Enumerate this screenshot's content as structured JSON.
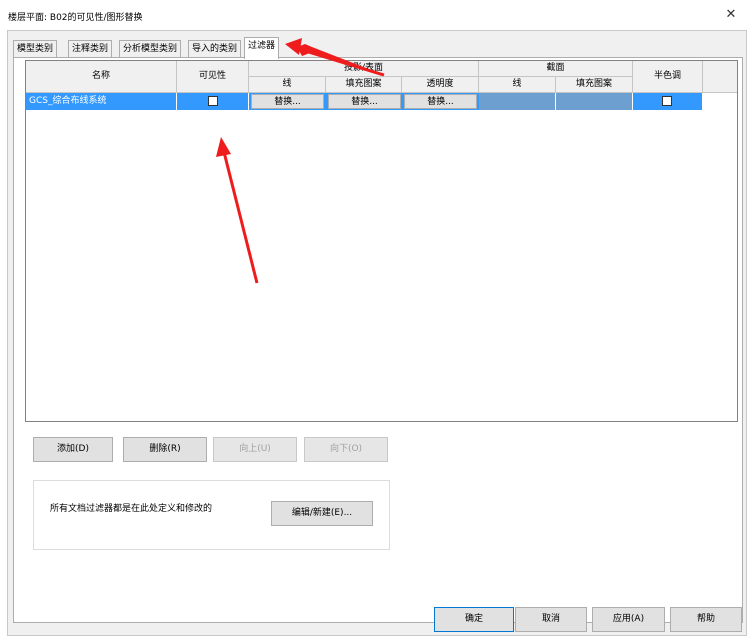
{
  "window": {
    "title": "楼层平面: B02的可见性/图形替换",
    "close_glyph": "✕"
  },
  "tabs": [
    {
      "label": "模型类别"
    },
    {
      "label": "注释类别"
    },
    {
      "label": "分析模型类别"
    },
    {
      "label": "导入的类别"
    },
    {
      "label": "过滤器"
    }
  ],
  "grid": {
    "headers": {
      "name": "名称",
      "visibility": "可见性",
      "projection_surface": "投影/表面",
      "proj_line": "线",
      "proj_fill": "填充图案",
      "proj_transparency": "透明度",
      "cut": "截面",
      "cut_line": "线",
      "cut_fill": "填充图案",
      "halftone": "半色调"
    },
    "rows": [
      {
        "name": "GCS_综合布线系统",
        "proj_line": "替换...",
        "proj_fill": "替换...",
        "proj_transparency": "替换..."
      }
    ]
  },
  "buttons": {
    "add": "添加(D)",
    "delete": "删除(R)",
    "up": "向上(U)",
    "down": "向下(O)",
    "edit_new": "编辑/新建(E)...",
    "ok": "确定",
    "cancel": "取消",
    "apply": "应用(A)",
    "help": "帮助"
  },
  "filters_box": {
    "text": "所有文档过滤器都是在此处定义和修改的"
  },
  "colors": {
    "selection": "#3399ff",
    "annotation_arrow": "#ee1c1c"
  }
}
